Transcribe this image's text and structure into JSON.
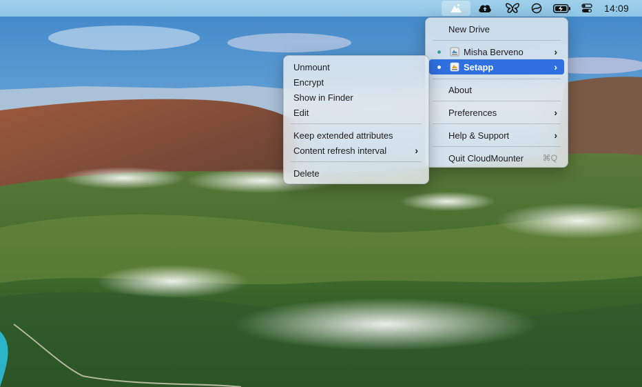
{
  "menubar": {
    "icons": [
      "cloudmounter-icon",
      "cloud-upload-icon",
      "butterfly-icon",
      "steer-icon",
      "battery-charging-icon",
      "control-center-icon"
    ],
    "clock": "14:09"
  },
  "main_menu": {
    "new_drive": "New Drive",
    "drives": [
      {
        "label": "Misha Berveno",
        "status": "connected"
      },
      {
        "label": "Setapp",
        "status": "connected"
      }
    ],
    "about": "About",
    "preferences": "Preferences",
    "help": "Help & Support",
    "quit": "Quit CloudMounter",
    "quit_shortcut": "⌘Q"
  },
  "submenu": {
    "items": [
      "Unmount",
      "Encrypt",
      "Show in Finder",
      "Edit",
      "Keep extended attributes",
      "Content refresh interval",
      "Delete"
    ]
  },
  "colors": {
    "selection": "#2f6fe0",
    "status_dot": "#3aa39a"
  }
}
